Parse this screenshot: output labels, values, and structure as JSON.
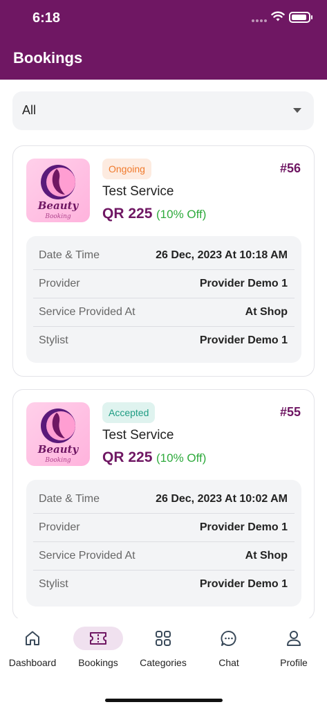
{
  "status_bar": {
    "time": "6:18"
  },
  "app_bar": {
    "title": "Bookings"
  },
  "filter": {
    "selected": "All"
  },
  "bookings": [
    {
      "status": "Ongoing",
      "id": "#56",
      "service": "Test Service",
      "price": "QR 225",
      "discount": "(10% Off)",
      "logo_text_1": "Beauty",
      "logo_text_2": "Booking",
      "details": [
        {
          "label": "Date & Time",
          "value": "26 Dec, 2023 At 10:18 AM"
        },
        {
          "label": "Provider",
          "value": "Provider Demo 1"
        },
        {
          "label": "Service Provided At",
          "value": "At Shop"
        },
        {
          "label": "Stylist",
          "value": "Provider Demo 1"
        }
      ]
    },
    {
      "status": "Accepted",
      "id": "#55",
      "service": "Test Service",
      "price": "QR 225",
      "discount": "(10% Off)",
      "logo_text_1": "Beauty",
      "logo_text_2": "Booking",
      "details": [
        {
          "label": "Date & Time",
          "value": "26 Dec, 2023 At 10:02 AM"
        },
        {
          "label": "Provider",
          "value": "Provider Demo 1"
        },
        {
          "label": "Service Provided At",
          "value": "At Shop"
        },
        {
          "label": "Stylist",
          "value": "Provider Demo 1"
        }
      ]
    }
  ],
  "bottom_nav": [
    {
      "label": "Dashboard",
      "icon": "home-icon"
    },
    {
      "label": "Bookings",
      "icon": "ticket-icon",
      "active": true
    },
    {
      "label": "Categories",
      "icon": "grid-icon"
    },
    {
      "label": "Chat",
      "icon": "chat-icon"
    },
    {
      "label": "Profile",
      "icon": "person-icon"
    }
  ],
  "colors": {
    "primary": "#6f1763",
    "ongoing": "#f07a2c",
    "accepted": "#1e9c83",
    "discount": "#2eaa3c"
  }
}
